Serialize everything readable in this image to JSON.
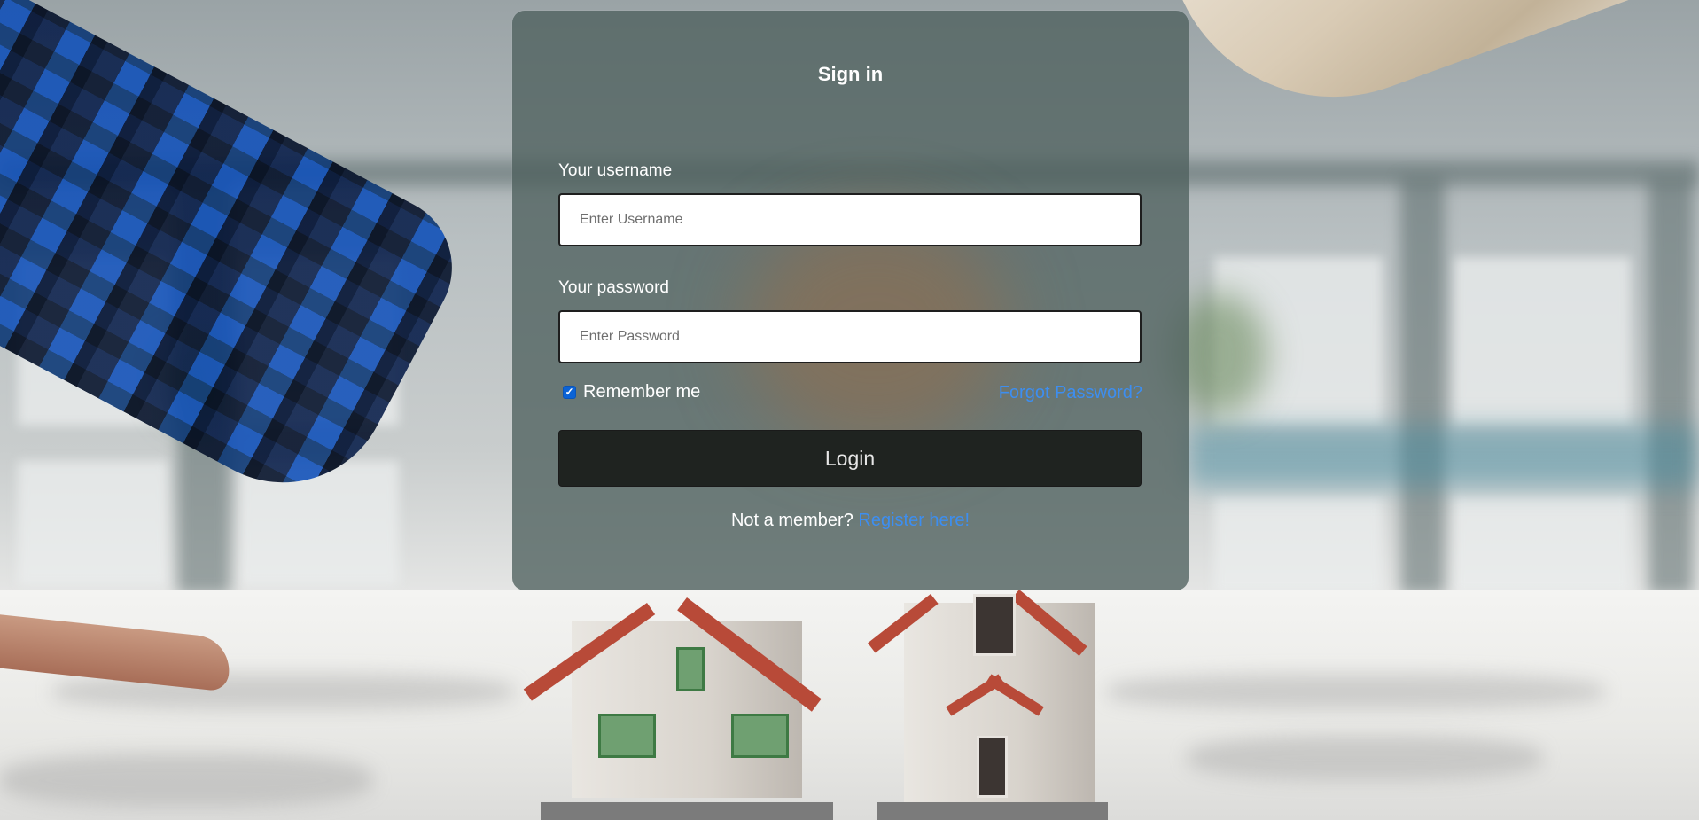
{
  "background": {
    "image": "house-models-handshake-photo"
  },
  "card": {
    "title": "Sign in",
    "username": {
      "label": "Your username",
      "placeholder": "Enter Username",
      "value": ""
    },
    "password": {
      "label": "Your password",
      "placeholder": "Enter Password",
      "value": ""
    },
    "remember": {
      "label": "Remember me",
      "checked": true
    },
    "forgot_link": "Forgot Password?",
    "login_button": "Login",
    "register": {
      "prompt": "Not a member?",
      "link": "Register here!"
    }
  },
  "colors": {
    "link": "#3d8ef0",
    "checkbox": "#0b63d6",
    "button_bg": "#1f2320",
    "card_bg": "rgba(78, 96, 94, 0.78)"
  },
  "icons": {
    "checkbox_mark": "checkmark-icon"
  }
}
